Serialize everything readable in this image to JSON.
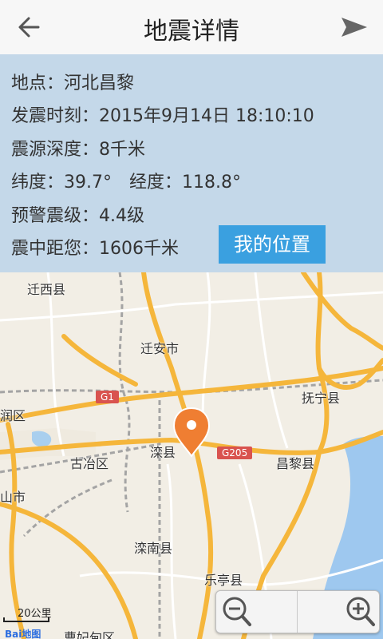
{
  "header": {
    "title": "地震详情",
    "back_icon": "arrow-left-icon",
    "send_icon": "send-icon"
  },
  "info": {
    "location": "地点：河北昌黎",
    "time": "发震时刻：2015年9月14日 18:10:10",
    "depth": "震源深度：8千米",
    "latitude": "纬度：39.7°",
    "longitude": "经度：118.8°",
    "warning_level": "预警震级：4.4级",
    "distance": "震中距您：1606千米",
    "my_location_button": "我的位置"
  },
  "map": {
    "places": {
      "qianxi": "迁西县",
      "qianan": "迁安市",
      "funing": "抚宁县",
      "runqu": "润区",
      "guye": "古冶区",
      "luanxian": "滦县",
      "changli": "昌黎县",
      "shanshi": "山市",
      "luannan": "滦南县",
      "laoting": "乐亭县",
      "caofeidian": "曹妃甸区"
    },
    "road_labels": {
      "g1": "G1",
      "g205": "G205"
    },
    "scale": "20公里",
    "logo": "Bai地图",
    "marker_icon": "location-pin-icon",
    "zoom_out_icon": "zoom-out-icon",
    "zoom_in_icon": "zoom-in-icon",
    "colors": {
      "road_major": "#f5b63b",
      "road_minor": "#ffffff",
      "rail": "#9a9a9a",
      "water": "#9ec8ef",
      "marker": "#ef7e32"
    }
  }
}
